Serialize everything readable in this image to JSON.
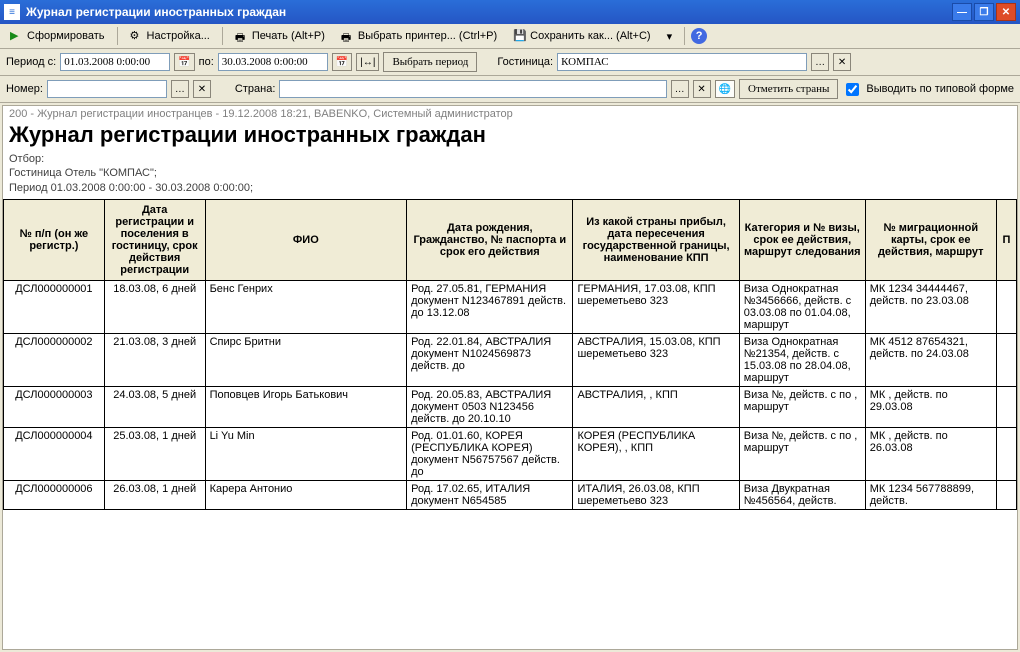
{
  "window": {
    "title": "Журнал регистрации иностранных граждан"
  },
  "toolbar": {
    "generate": "Сформировать",
    "settings": "Настройка...",
    "print": "Печать (Alt+P)",
    "select_printer": "Выбрать принтер... (Ctrl+P)",
    "save_as": "Сохранить как... (Alt+C)"
  },
  "params": {
    "period_from_label": "Период с:",
    "period_from": "01.03.2008 0:00:00",
    "to_label": "по:",
    "period_to": "30.03.2008 0:00:00",
    "select_period": "Выбрать период",
    "hotel_label": "Гостиница:",
    "hotel": "КОМПАС",
    "number_label": "Номер:",
    "number": "",
    "country_label": "Страна:",
    "country": "",
    "mark_countries": "Отметить страны",
    "output_typical": "Выводить по типовой форме"
  },
  "report": {
    "meta": "200 - Журнал регистрации иностранцев - 19.12.2008 18:21, BABENKO, Системный администратор",
    "title": "Журнал регистрации иностранных граждан",
    "filter1": "Отбор:",
    "filter2": "Гостиница Отель \"КОМПАС\";",
    "filter3": "Период 01.03.2008 0:00:00 - 30.03.2008 0:00:00;",
    "cols": {
      "c1": "№ п/п\n(он же регистр.)",
      "c2": "Дата регистрации и поселения в гостиницу, срок действия регистрации",
      "c3": "ФИО",
      "c4": "Дата рождения, Гражданство, № паспорта и срок его действия",
      "c5": "Из какой страны прибыл, дата пересечения государственной границы, наименование КПП",
      "c6": "Категория и № визы, срок ее действия, маршрут следования",
      "c7": "№ миграционной карты, срок ее действия, маршрут",
      "c8": "П"
    },
    "rows": [
      {
        "c1": "ДСЛ000000001",
        "c2": "18.03.08, 6 дней",
        "c3": "Бенс Генрих",
        "c4": "Род. 27.05.81, ГЕРМАНИЯ документ N123467891 действ. до 13.12.08",
        "c5": "ГЕРМАНИЯ, 17.03.08, КПП шереметьево 323",
        "c6": "Виза Однократная №3456666, действ. с 03.03.08 по 01.04.08, маршрут",
        "c7": "МК 1234 34444467, действ. по 23.03.08"
      },
      {
        "c1": "ДСЛ000000002",
        "c2": "21.03.08, 3 дней",
        "c3": "Спирс Бритни",
        "c4": "Род. 22.01.84, АВСТРАЛИЯ документ N1024569873 действ. до",
        "c5": "АВСТРАЛИЯ, 15.03.08, КПП шереметьево 323",
        "c6": "Виза Однократная №21354, действ. с 15.03.08 по 28.04.08, маршрут",
        "c7": "МК 4512 87654321, действ. по 24.03.08"
      },
      {
        "c1": "ДСЛ000000003",
        "c2": "24.03.08, 5 дней",
        "c3": "Поповцев Игорь Батькович",
        "c4": "Род. 20.05.83, АВСТРАЛИЯ документ 0503 N123456 действ. до 20.10.10",
        "c5": "АВСТРАЛИЯ, , КПП",
        "c6": "Виза  №, действ. с  по , маршрут",
        "c7": "МК , действ. по 29.03.08"
      },
      {
        "c1": "ДСЛ000000004",
        "c2": "25.03.08, 1 дней",
        "c3": "Li Yu Min",
        "c4": "Род. 01.01.60, КОРЕЯ (РЕСПУБЛИКА КОРЕЯ) документ N56757567 действ. до",
        "c5": "КОРЕЯ (РЕСПУБЛИКА КОРЕЯ), , КПП",
        "c6": "Виза  №, действ. с  по , маршрут",
        "c7": "МК , действ. по 26.03.08"
      },
      {
        "c1": "ДСЛ000000006",
        "c2": "26.03.08, 1 дней",
        "c3": "Карера Антонио",
        "c4": "Род. 17.02.65, ИТАЛИЯ документ N654585",
        "c5": "ИТАЛИЯ, 26.03.08, КПП шереметьево 323",
        "c6": "Виза Двукратная №456564, действ.",
        "c7": "МК 1234 567788899, действ."
      }
    ]
  }
}
